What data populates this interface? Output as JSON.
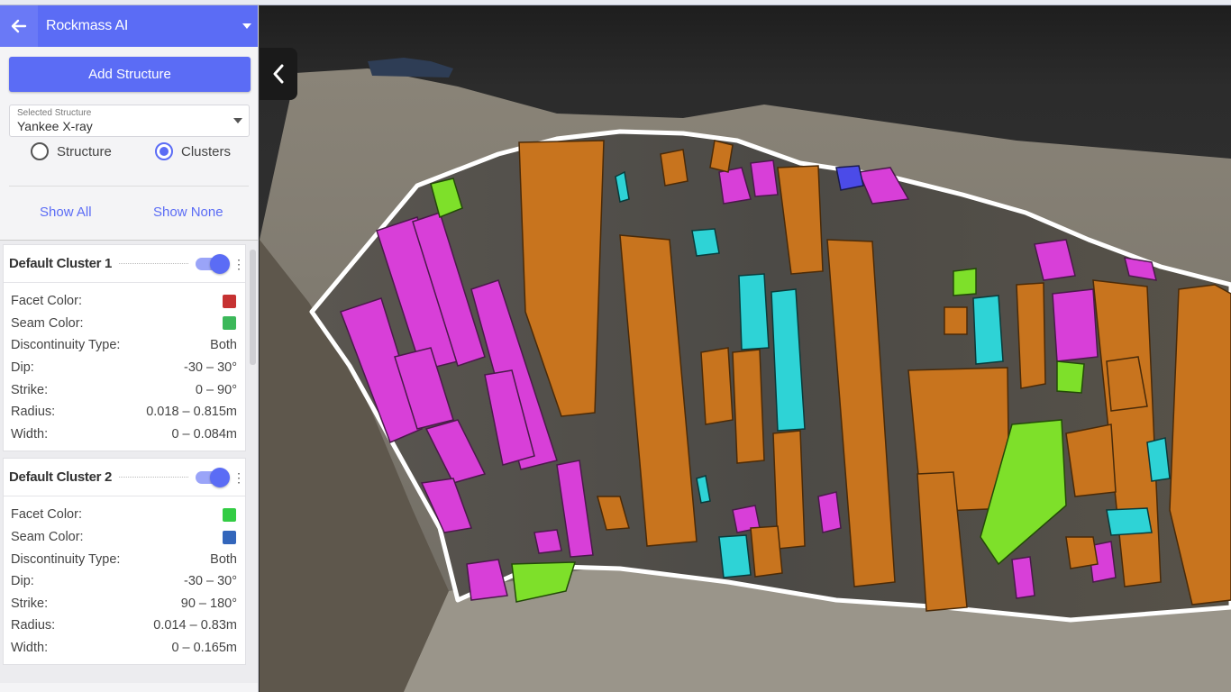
{
  "app": {
    "title": "Rockmass AI"
  },
  "toolbar": {
    "add_structure_label": "Add Structure"
  },
  "selected_structure": {
    "label": "Selected Structure",
    "value": "Yankee X-ray"
  },
  "view_mode": {
    "options": [
      "Structure",
      "Clusters"
    ],
    "selected": "Clusters"
  },
  "visibility": {
    "show_all": "Show All",
    "show_none": "Show None"
  },
  "clusters": [
    {
      "name": "Default Cluster 1",
      "enabled": true,
      "facet_color_label": "Facet Color:",
      "facet_color": "#cc3333",
      "seam_color_label": "Seam Color:",
      "seam_color": "#33bb55",
      "discontinuity_type_label": "Discontinuity Type:",
      "discontinuity_type": "Both",
      "dip_label": "Dip:",
      "dip": "-30 – 30°",
      "strike_label": "Strike:",
      "strike": "0 – 90°",
      "radius_label": "Radius:",
      "radius": "0.018 – 0.815m",
      "width_label": "Width:",
      "width": "0 – 0.084m"
    },
    {
      "name": "Default Cluster 2",
      "enabled": true,
      "facet_color_label": "Facet Color:",
      "facet_color": "#33cc44",
      "seam_color_label": "Seam Color:",
      "seam_color": "#3366bb",
      "discontinuity_type_label": "Discontinuity Type:",
      "discontinuity_type": "Both",
      "dip_label": "Dip:",
      "dip": "-30 – 30°",
      "strike_label": "Strike:",
      "strike": "90 – 180°",
      "radius_label": "Radius:",
      "radius": "0.014 – 0.83m",
      "width_label": "Width:",
      "width": "0 – 0.165m"
    }
  ],
  "colors": {
    "accent": "#5b6cf5",
    "facet_orange": "#c8741e",
    "facet_magenta": "#d83fd8",
    "facet_cyan": "#2ed3d6",
    "facet_green": "#7ee02a"
  }
}
